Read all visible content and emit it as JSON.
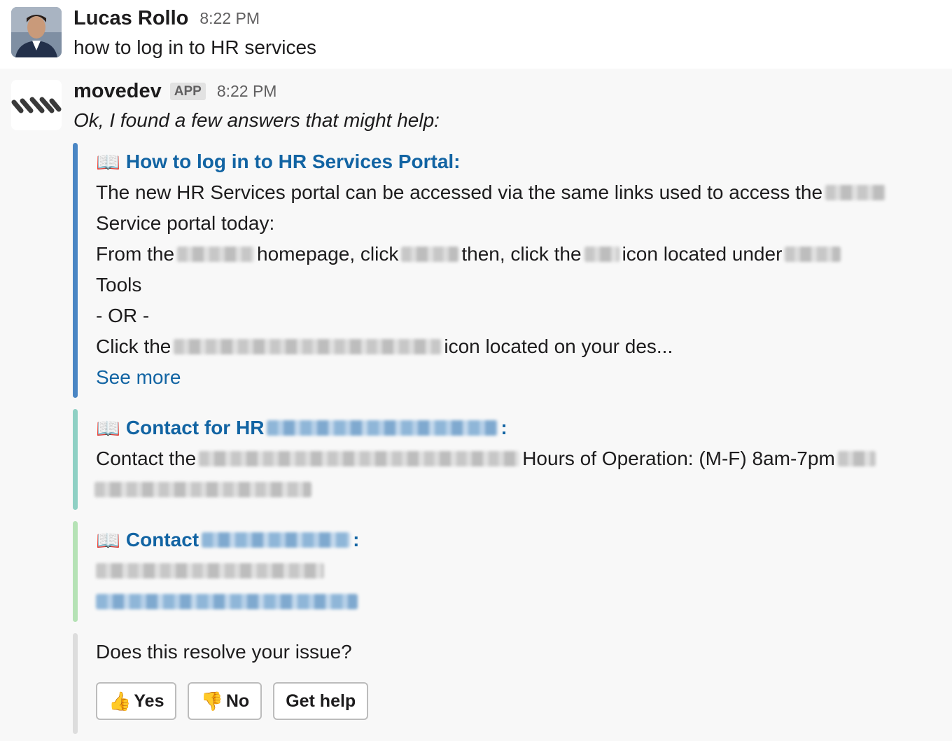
{
  "messages": [
    {
      "sender": "Lucas Rollo",
      "time": "8:22 PM",
      "text": "how to log in to HR services"
    },
    {
      "sender": "movedev",
      "badge": "APP",
      "time": "8:22 PM",
      "text": "Ok, I found a few answers that might help:"
    }
  ],
  "attachments": [
    {
      "title": "How to log in to HR Services Portal:",
      "bar_color": "#4a86c4",
      "lines": {
        "l1_a": "The new HR Services portal can be accessed via the same links used to access the",
        "l2": "Service portal today:",
        "l3_a": "From the",
        "l3_b": "homepage, click",
        "l3_c": "then, click the",
        "l3_d": "icon located under",
        "l4": "Tools",
        "l5": "- OR -",
        "l6_a": "Click the",
        "l6_b": "icon located on your des..."
      },
      "see_more": "See more"
    },
    {
      "title": "Contact for HR",
      "title_suffix": ":",
      "bar_color": "#8fd0c4",
      "line_a": "Contact the",
      "line_b": "Hours of Operation: (M-F) 8am-7pm"
    },
    {
      "title": "Contact",
      "title_suffix": ":",
      "bar_color": "#b5e2b5"
    },
    {
      "question": "Does this resolve your issue?",
      "bar_color": "#dddddd",
      "buttons": {
        "yes": "Yes",
        "no": "No",
        "help": "Get help"
      }
    }
  ],
  "icons": {
    "book": "📖",
    "thumbs_up": "👍",
    "thumbs_down": "👎"
  }
}
